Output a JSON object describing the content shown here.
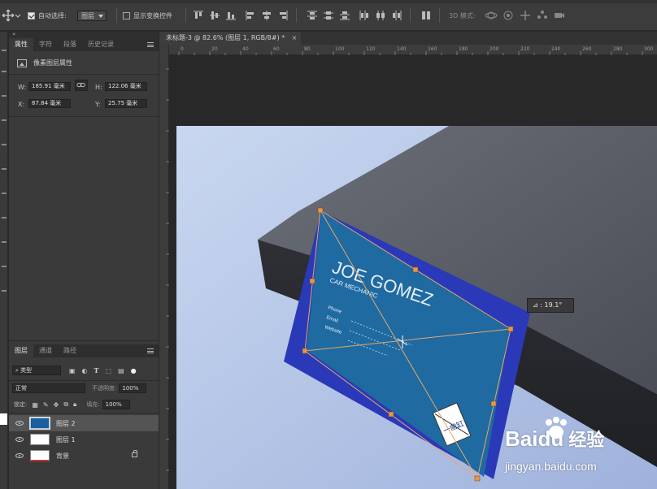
{
  "options_bar": {
    "auto_select_label": "自动选择:",
    "auto_select_value": "图层",
    "show_transform_label": "显示变换控件",
    "mode_3d_label": "3D 模式:"
  },
  "properties_panel": {
    "tabs": [
      {
        "label": "属性"
      },
      {
        "label": "字符"
      },
      {
        "label": "段落"
      },
      {
        "label": "历史记录"
      }
    ],
    "section_title": "像素图层属性",
    "fields": {
      "w_label": "W:",
      "w_value": "185.91 毫米",
      "h_label": "H:",
      "h_value": "122.06 毫米",
      "x_label": "X:",
      "x_value": "87.84 毫米",
      "y_label": "Y:",
      "y_value": "25.75 毫米"
    }
  },
  "layers_panel": {
    "tabs": [
      {
        "label": "图层"
      },
      {
        "label": "通道"
      },
      {
        "label": "路径"
      }
    ],
    "filter_kind": "类型",
    "blend_mode": "正常",
    "opacity_label": "不透明度:",
    "opacity_value": "100%",
    "lock_label": "锁定:",
    "fill_label": "填充:",
    "fill_value": "100%",
    "layers": [
      {
        "name": "图层 2",
        "selected": true
      },
      {
        "name": "图层 1",
        "selected": false
      },
      {
        "name": "背景",
        "selected": false
      }
    ]
  },
  "document": {
    "tab_title": "未标题-3 @ 82.6% (图层 1, RGB/8#) *",
    "ruler_ticks": [
      "0",
      "20",
      "40",
      "60",
      "80",
      "100",
      "120",
      "140",
      "160",
      "180",
      "200",
      "220",
      "240",
      "260",
      "280",
      "300"
    ]
  },
  "canvas": {
    "card_name": "JOE GOMEZ",
    "card_subtitle": "CAR MECHANIC",
    "card_lines": [
      "Phone",
      "Email",
      "Website"
    ],
    "sticker_text": "一凿缸",
    "transform_angle": "19.1°"
  },
  "watermark": {
    "brand": "Baidu",
    "brand_cn": "经验",
    "url": "jingyan.baidu.com"
  },
  "colors": {
    "card_blue": "#1f6aa0",
    "card_dark_blue": "#2235b0",
    "handle_orange": "#e7964a",
    "panel_bg": "#3a3a3a",
    "baidu_blue": "#2932e1",
    "baidu_red": "#e10602"
  }
}
